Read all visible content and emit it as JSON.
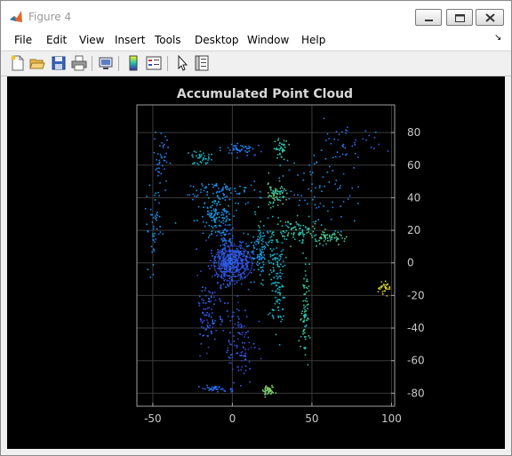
{
  "window": {
    "title": "Figure 4"
  },
  "menu": [
    "File",
    "Edit",
    "View",
    "Insert",
    "Tools",
    "Desktop",
    "Window",
    "Help"
  ],
  "toolbar": [
    "new-figure-icon",
    "open-file-icon",
    "save-icon",
    "print-icon",
    "link-plot-icon",
    "insert-colorbar-icon",
    "insert-legend-icon",
    "edit-plot-arrow-icon",
    "property-inspector-icon"
  ],
  "colors": {
    "background": "#000000",
    "axes": "#a0a0a0",
    "grid": "#3a3a3a",
    "title": "#d8d8d8"
  },
  "chart_data": {
    "type": "scatter",
    "title": "Accumulated Point Cloud",
    "xlabel": "",
    "ylabel": "",
    "xlim": [
      -60,
      102
    ],
    "ylim": [
      -88,
      97
    ],
    "xticks": [
      -50,
      0,
      50,
      100
    ],
    "yticks": [
      80,
      60,
      40,
      20,
      0,
      -20,
      -40,
      -60,
      -80
    ],
    "y_axis_side": "right",
    "grid": true,
    "colormap": "parula",
    "clusters": [
      {
        "x": 0,
        "y": 2,
        "spread": [
          11,
          10
        ],
        "n": 260,
        "level": 0.15
      },
      {
        "x": -5,
        "y": 5,
        "spread": [
          5,
          22
        ],
        "n": 120,
        "level": 0.2
      },
      {
        "x": -12,
        "y": 30,
        "spread": [
          10,
          10
        ],
        "n": 120,
        "level": 0.35
      },
      {
        "x": -8,
        "y": 45,
        "spread": [
          20,
          5
        ],
        "n": 80,
        "level": 0.3
      },
      {
        "x": 5,
        "y": 70,
        "spread": [
          12,
          3
        ],
        "n": 50,
        "level": 0.25
      },
      {
        "x": -20,
        "y": 65,
        "spread": [
          6,
          4
        ],
        "n": 40,
        "level": 0.45
      },
      {
        "x": 30,
        "y": 70,
        "spread": [
          4,
          5
        ],
        "n": 40,
        "level": 0.55
      },
      {
        "x": 27,
        "y": 43,
        "spread": [
          5,
          6
        ],
        "n": 70,
        "level": 0.6
      },
      {
        "x": 40,
        "y": 20,
        "spread": [
          12,
          6
        ],
        "n": 90,
        "level": 0.55
      },
      {
        "x": 60,
        "y": 16,
        "spread": [
          10,
          3
        ],
        "n": 60,
        "level": 0.6
      },
      {
        "x": 18,
        "y": 10,
        "spread": [
          6,
          15
        ],
        "n": 100,
        "level": 0.4
      },
      {
        "x": 28,
        "y": -10,
        "spread": [
          4,
          25
        ],
        "n": 130,
        "level": 0.45
      },
      {
        "x": 45,
        "y": -30,
        "spread": [
          2,
          25
        ],
        "n": 80,
        "level": 0.55
      },
      {
        "x": -15,
        "y": -30,
        "spread": [
          6,
          22
        ],
        "n": 100,
        "level": 0.15
      },
      {
        "x": 5,
        "y": -50,
        "spread": [
          8,
          20
        ],
        "n": 100,
        "level": 0.12
      },
      {
        "x": 22,
        "y": -78,
        "spread": [
          3,
          3
        ],
        "n": 50,
        "level": 0.7
      },
      {
        "x": -10,
        "y": -77,
        "spread": [
          10,
          2
        ],
        "n": 40,
        "level": 0.2
      },
      {
        "x": -50,
        "y": 25,
        "spread": [
          4,
          20
        ],
        "n": 50,
        "level": 0.3
      },
      {
        "x": -45,
        "y": 65,
        "spread": [
          4,
          15
        ],
        "n": 40,
        "level": 0.25
      },
      {
        "x": 95,
        "y": -15,
        "spread": [
          3,
          4
        ],
        "n": 30,
        "level": 0.85
      },
      {
        "x": 75,
        "y": 72,
        "spread": [
          15,
          8
        ],
        "n": 40,
        "level": 0.2
      },
      {
        "x": 55,
        "y": 45,
        "spread": [
          20,
          20
        ],
        "n": 80,
        "level": 0.3
      }
    ]
  }
}
